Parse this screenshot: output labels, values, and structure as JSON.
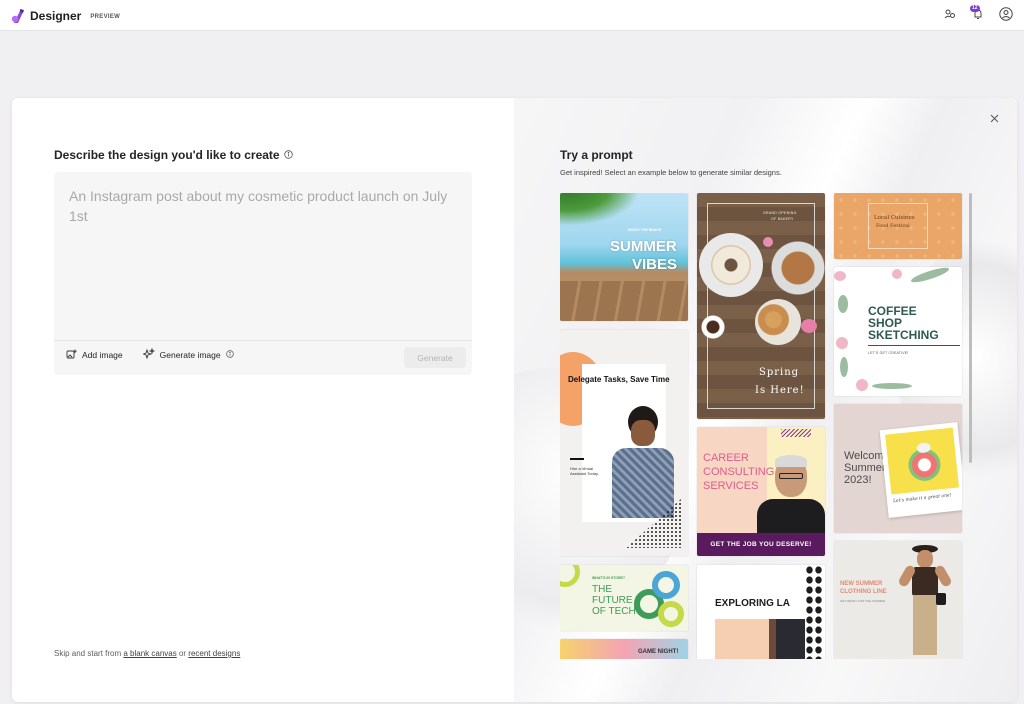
{
  "app": {
    "title": "Designer",
    "badge": "PREVIEW",
    "notification_count": "12"
  },
  "left": {
    "heading": "Describe the design you'd like to create",
    "prompt_placeholder": "An Instagram post about my cosmetic product launch on July 1st",
    "add_image": "Add image",
    "generate_image": "Generate image",
    "generate": "Generate",
    "skip_prefix": "Skip and start from ",
    "blank_canvas": "a blank canvas",
    "skip_mid": " or ",
    "recent_designs": "recent designs"
  },
  "right": {
    "heading": "Try a prompt",
    "subheading": "Get inspired! Select an example below to generate similar designs."
  },
  "tiles": {
    "summer": {
      "kicker": "ENJOY THE BEACH",
      "line1": "SUMMER",
      "line2": "VIBES"
    },
    "bakery": {
      "kicker1": "GRAND OPENING",
      "kicker2": "OF BAKERY",
      "line1": "Spring",
      "line2": "Is Here!"
    },
    "cafe": {
      "line1": "Local Cuisines",
      "line2": "Food Festival"
    },
    "coffee": {
      "line1": "COFFEE",
      "line2": "SHOP",
      "line3": "SKETCHING",
      "sub": "LET'S GET CREATIVE!"
    },
    "delegate": {
      "title": "Delegate Tasks, Save Time",
      "sub": "Hire a Virtual Assistant Today."
    },
    "career": {
      "title1": "CAREER",
      "title2": "CONSULTING",
      "title3": "SERVICES",
      "banner": "GET THE JOB YOU DESERVE!"
    },
    "welcome": {
      "line1": "Welcome",
      "line2": "Summer",
      "line3": "2023!",
      "note": "Let's make it a great one!"
    },
    "tech": {
      "kicker": "WHAT'S IN STORE?",
      "line1": "THE",
      "line2": "FUTURE",
      "line3": "OF TECH"
    },
    "la": {
      "title": "EXPLORING LA"
    },
    "clothing": {
      "line1": "NEW SUMMER",
      "line2": "CLOTHING LINE",
      "sub": "GET READY FOR THE SUMMER"
    },
    "game": {
      "title": "GAME NIGHT!"
    }
  },
  "colors": {
    "accent": "#7e3bd3",
    "career_banner": "#5a1a5e",
    "tech_green": "#3e9b5a",
    "coffee_text": "#2d5b52"
  }
}
